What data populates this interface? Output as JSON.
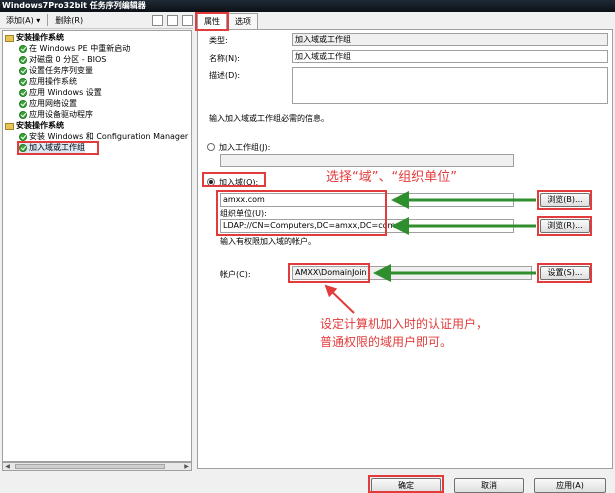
{
  "window": {
    "title": "Windows7Pro32bit 任务序列编辑器"
  },
  "toolbar": {
    "add_label": "添加(A) ▾",
    "remove_label": "删除(R)"
  },
  "tree": [
    {
      "label": "安装操作系统",
      "type": "group"
    },
    {
      "label": "在 Windows PE 中重新启动",
      "type": "step"
    },
    {
      "label": "对磁盘 0 分区 - BIOS",
      "type": "step"
    },
    {
      "label": "设置任务序列变量",
      "type": "step"
    },
    {
      "label": "应用操作系统",
      "type": "step"
    },
    {
      "label": "应用 Windows 设置",
      "type": "step"
    },
    {
      "label": "应用网络设置",
      "type": "step"
    },
    {
      "label": "应用设备驱动程序",
      "type": "step"
    },
    {
      "label": "安装操作系统",
      "type": "group"
    },
    {
      "label": "安装 Windows 和 Configuration Manager",
      "type": "step"
    },
    {
      "label": "加入域或工作组",
      "type": "step",
      "selected": true
    }
  ],
  "tabs": {
    "properties": "属性",
    "options": "选项"
  },
  "form": {
    "type_label": "类型:",
    "type_value": "加入域或工作组",
    "name_label": "名称(N):",
    "name_value": "加入域或工作组",
    "desc_label": "描述(D):",
    "desc_value": "",
    "info_text": "输入加入域或工作组必需的信息。",
    "workgroup_label": "加入工作组(J):",
    "domain_label": "加入域(O):",
    "domain_value": "amxx.com",
    "ou_label": "组织单位(U):",
    "ou_value": "LDAP://CN=Computers,DC=amxx,DC=com",
    "account_info": "输入有权限加入域的帐户。",
    "account_label": "帐户(C):",
    "account_value": "AMXX\\DomainJoin",
    "browse1": "浏览(B)...",
    "browse2": "浏览(R)...",
    "set_button": "设置(S)..."
  },
  "annotations": {
    "top": "选择“域”、“组织单位”",
    "bottom_line1": "设定计算机加入时的认证用户，",
    "bottom_line2": "普通权限的域用户即可。"
  },
  "footer": {
    "ok": "确定",
    "cancel": "取消",
    "apply": "应用(A)"
  },
  "colors": {
    "annotation": "#e23b3b",
    "arrow": "#2f8f2f"
  }
}
